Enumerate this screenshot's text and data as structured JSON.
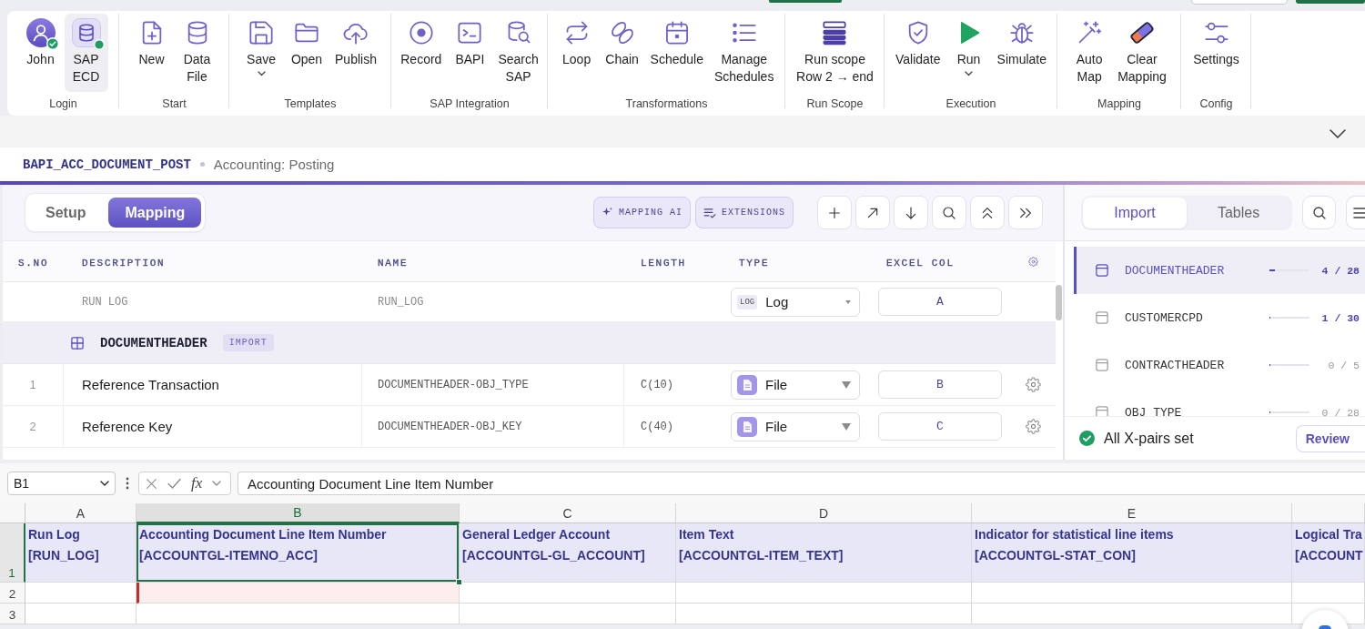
{
  "ribbon": {
    "groups": [
      {
        "label": "Login",
        "items": [
          {
            "label": "John",
            "selected": false,
            "connected": true
          },
          {
            "label": "SAP\nECD",
            "selected": true,
            "connected": true
          }
        ]
      },
      {
        "label": "Start",
        "items": [
          {
            "label": "New"
          },
          {
            "label": "Data\nFile"
          }
        ]
      },
      {
        "label": "Templates",
        "items": [
          {
            "label": "Save",
            "dropdown": true
          },
          {
            "label": "Open",
            "dropdown": false
          },
          {
            "label": "Publish",
            "dropdown": false
          }
        ]
      },
      {
        "label": "SAP Integration",
        "items": [
          {
            "label": "Record"
          },
          {
            "label": "BAPI"
          },
          {
            "label": "Search\nSAP"
          }
        ]
      },
      {
        "label": "Transformations",
        "items": [
          {
            "label": "Loop"
          },
          {
            "label": "Chain"
          },
          {
            "label": "Schedule"
          },
          {
            "label": "Manage\nSchedules"
          }
        ]
      },
      {
        "label": "Run Scope",
        "items": [
          {
            "label": "Run scope\nRow 2 → end"
          }
        ]
      },
      {
        "label": "Execution",
        "items": [
          {
            "label": "Validate",
            "dropdown": false
          },
          {
            "label": "Run",
            "dropdown": true
          },
          {
            "label": "Simulate",
            "dropdown": false
          }
        ]
      },
      {
        "label": "Mapping",
        "items": [
          {
            "label": "Auto\nMap"
          },
          {
            "label": "Clear\nMapping"
          }
        ]
      },
      {
        "label": "Config",
        "items": [
          {
            "label": "Settings"
          }
        ]
      }
    ]
  },
  "breadcrumb": {
    "function": "BAPI_ACC_DOCUMENT_POST",
    "description": "Accounting: Posting"
  },
  "mapping": {
    "view_tabs": [
      {
        "label": "Setup",
        "selected": false
      },
      {
        "label": "Mapping",
        "selected": true
      }
    ],
    "actions": [
      {
        "label": "MAPPING AI"
      },
      {
        "label": "EXTENSIONS"
      }
    ],
    "table": {
      "columns": [
        "S.NO",
        "DESCRIPTION",
        "NAME",
        "LENGTH",
        "TYPE",
        "EXCEL COL"
      ],
      "rows": [
        {
          "kind": "log",
          "description": "RUN LOG",
          "name": "RUN_LOG",
          "type_badge": "LOG",
          "type": "Log",
          "excel_col": "A"
        },
        {
          "kind": "group",
          "title": "DOCUMENTHEADER",
          "badge": "IMPORT"
        },
        {
          "kind": "field",
          "sno": "1",
          "description": "Reference Transaction",
          "name": "DOCUMENTHEADER-OBJ_TYPE",
          "length": "C(10)",
          "type": "File",
          "excel_col": "B"
        },
        {
          "kind": "field",
          "sno": "2",
          "description": "Reference Key",
          "name": "DOCUMENTHEADER-OBJ_KEY",
          "length": "C(40)",
          "type": "File",
          "excel_col": "C"
        }
      ]
    }
  },
  "structures": {
    "tabs": [
      {
        "label": "Import",
        "selected": true
      },
      {
        "label": "Tables",
        "selected": false
      }
    ],
    "items": [
      {
        "name": "DOCUMENTHEADER",
        "count": "4 / 28",
        "level": 0.14,
        "selected": true
      },
      {
        "name": "CUSTOMERCPD",
        "count": "1 / 30",
        "level": 0.03,
        "selected": false
      },
      {
        "name": "CONTRACTHEADER",
        "count": "0 / 5",
        "level": 0,
        "selected": false
      },
      {
        "name": "OBJ TYPE",
        "count": "0 / 28",
        "level": 0,
        "selected": false
      }
    ],
    "status": "All X-pairs set",
    "review_button": "Review"
  },
  "sheet": {
    "name_box": "B1",
    "function_symbol": "fx",
    "formula": "Accounting Document Line Item Number",
    "columns": [
      {
        "label": "A",
        "selected": false
      },
      {
        "label": "B",
        "selected": true
      },
      {
        "label": "C",
        "selected": false
      },
      {
        "label": "D",
        "selected": false
      },
      {
        "label": "E",
        "selected": false
      }
    ],
    "rows": [
      {
        "number": "1",
        "selected": true,
        "cells": [
          {
            "title": "Run Log",
            "field": "[RUN_LOG]",
            "selected": false
          },
          {
            "title": "Accounting Document Line Item Number",
            "field": "[ACCOUNTGL-ITEMNO_ACC]",
            "selected": true
          },
          {
            "title": "General Ledger Account",
            "field": "[ACCOUNTGL-GL_ACCOUNT]",
            "selected": false
          },
          {
            "title": "Item Text",
            "field": "[ACCOUNTGL-ITEM_TEXT]",
            "selected": false
          },
          {
            "title": "Indicator for statistical line items",
            "field": "[ACCOUNTGL-STAT_CON]",
            "selected": false
          },
          {
            "title": "Logical Tra",
            "field": "[ACCOUNT",
            "selected": false
          }
        ]
      },
      {
        "number": "2",
        "selected": false,
        "cells": [
          {
            "flagged": false
          },
          {
            "flagged": true
          },
          {
            "flagged": false
          },
          {
            "flagged": false
          },
          {
            "flagged": false
          },
          {
            "flagged": false
          }
        ]
      },
      {
        "number": "3",
        "selected": false
      }
    ]
  }
}
